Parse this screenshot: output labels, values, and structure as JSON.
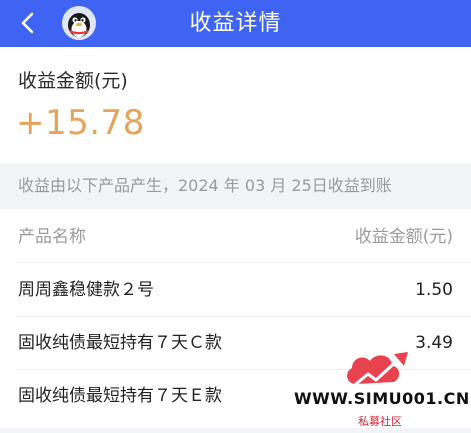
{
  "header": {
    "title": "收益详情",
    "back_icon": "chevron-left-icon",
    "avatar_icon": "penguin-avatar-icon",
    "background": "#3f63f3"
  },
  "summary": {
    "label": "收益金额(元)",
    "amount": "+15.78",
    "amount_color": "#e6a35c"
  },
  "notice": {
    "text": "收益由以下产品产生，2024 年 03 月 25日收益到账"
  },
  "table": {
    "columns": [
      "产品名称",
      "收益金额(元)"
    ],
    "rows": [
      {
        "name": "周周鑫稳健款２号",
        "value": "1.50"
      },
      {
        "name": "固收纯债最短持有７天Ｃ款",
        "value": "3.49"
      },
      {
        "name": "固收纯债最短持有７天Ｅ款",
        "value": ""
      }
    ]
  },
  "watermark": {
    "site": "WWW.SIMU001.CN",
    "caption": "私募社区",
    "logo_color": "#e8424f"
  }
}
